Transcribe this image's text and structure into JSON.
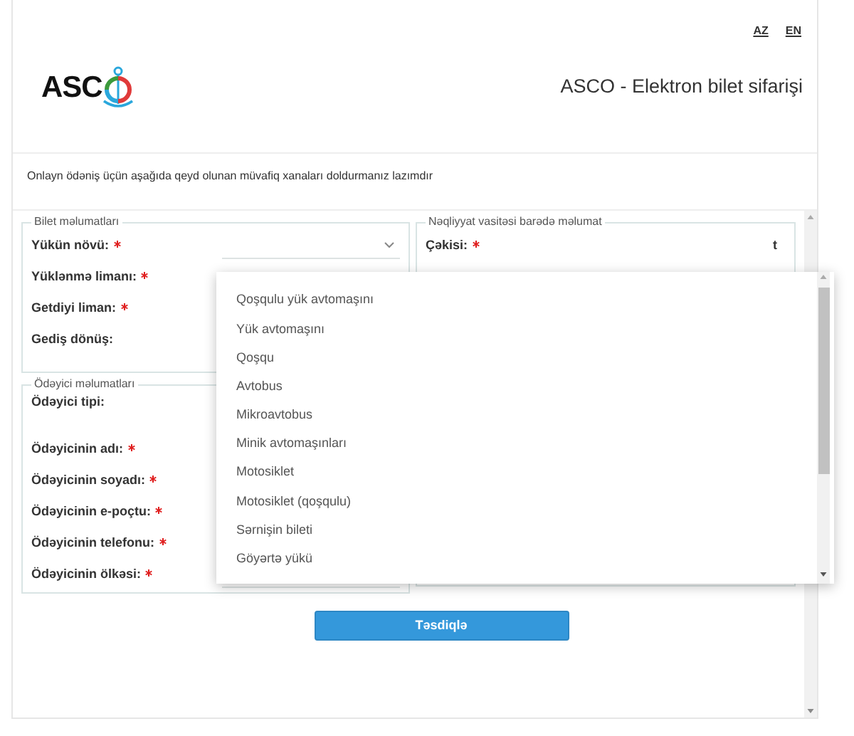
{
  "languages": [
    {
      "label": "AZ"
    },
    {
      "label": "EN"
    }
  ],
  "logo": {
    "text": "ASC"
  },
  "title": "ASCO - Elektron bilet sifarişi",
  "intro": "Onlayn ödəniş üçün aşağıda qeyd olunan müvafiq xanaları doldurmanız lazımdır",
  "sections": [
    {
      "legend": "Bilet məlumatları",
      "fields": [
        {
          "label": "Yükün növü:",
          "required": true,
          "kind": "select"
        },
        {
          "label": "Yüklənmə limanı:",
          "required": true,
          "kind": "text"
        },
        {
          "label": "Getdiyi liman:",
          "required": true,
          "kind": "text"
        },
        {
          "label": "Gediş dönüş:",
          "required": false,
          "kind": "text"
        }
      ]
    },
    {
      "legend": "Ödəyici məlumatları",
      "fields": [
        {
          "label": "Ödəyici tipi:",
          "required": false,
          "kind": "tall"
        },
        {
          "label": "Ödəyicinin adı:",
          "required": true,
          "kind": "text"
        },
        {
          "label": "Ödəyicinin soyadı:",
          "required": true,
          "kind": "text"
        },
        {
          "label": "Ödəyicinin e-poçtu:",
          "required": true,
          "kind": "text"
        },
        {
          "label": "Ödəyicinin telefonu:",
          "required": true,
          "kind": "text"
        },
        {
          "label": "Ödəyicinin ölkəsi:",
          "required": true,
          "kind": "select"
        }
      ]
    }
  ],
  "vehicle": {
    "legend": "Nəqliyyat vasitəsi barədə məlumat",
    "fields": [
      {
        "label": "Çəkisi:",
        "required": true,
        "unit": "t"
      }
    ]
  },
  "dropdown": {
    "options": [
      {
        "label": "Qoşqulu yük avtomaşını"
      },
      {
        "label": "Yük avtomaşını"
      },
      {
        "label": "Qoşqu"
      },
      {
        "label": "Avtobus"
      },
      {
        "label": "Mikroavtobus"
      },
      {
        "label": "Minik avtomaşınları"
      },
      {
        "label": "Motosiklet"
      },
      {
        "label": "Motosiklet (qoşqulu)"
      },
      {
        "label": "Sərnişin bileti"
      },
      {
        "label": "Göyərtə yükü"
      }
    ]
  },
  "submit": "Təsdiqlə"
}
